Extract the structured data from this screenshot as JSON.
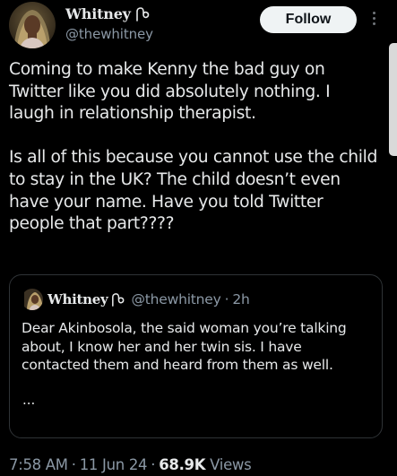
{
  "author": {
    "name": "Whitney",
    "handle": "@thewhitney",
    "badge_icon": "ribbon-badge-icon",
    "avatar": "avatar"
  },
  "actions": {
    "follow_label": "Follow",
    "more_icon": "more-vertical-icon"
  },
  "tweet": {
    "paragraphs": [
      "Coming to make Kenny the bad guy on Twitter like you did absolutely nothing. I laugh in relationship therapist.",
      "Is all of this because you cannot use the child to stay in the UK? The child doesn’t even have your name. Have you told Twitter people that part????"
    ]
  },
  "quote": {
    "name": "Whitney",
    "handle": "@thewhitney",
    "separator": "·",
    "time": "2h",
    "text": "Dear Akinbosola, the said woman you’re talking about, I know her and her twin sis. I have contacted them and heard from them as well.",
    "truncation": "..."
  },
  "meta": {
    "time": "7:58 AM",
    "date": "11 Jun 24",
    "views_count": "68.9K",
    "views_label": "Views",
    "separator": "·"
  },
  "colors": {
    "background": "#000000",
    "text_primary": "#e7e9ea",
    "text_secondary": "#8b98a5",
    "border": "#2f3336",
    "follow_bg": "#eff3f4",
    "follow_text": "#0f1419"
  }
}
